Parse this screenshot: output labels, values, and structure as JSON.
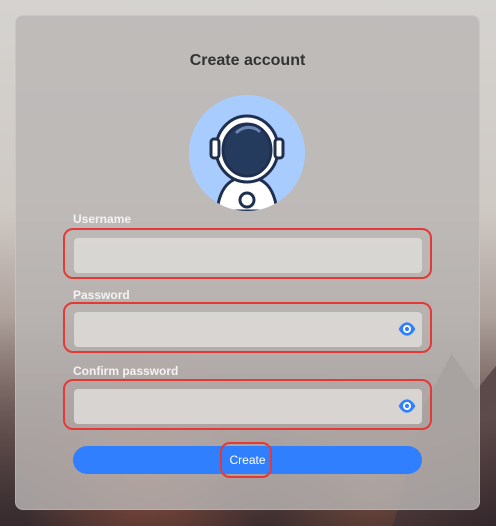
{
  "window": {
    "title": "Create account"
  },
  "form": {
    "username": {
      "label": "Username",
      "value": "",
      "placeholder": ""
    },
    "password": {
      "label": "Password",
      "value": "",
      "placeholder": ""
    },
    "confirm_password": {
      "label": "Confirm password",
      "value": "",
      "placeholder": ""
    },
    "create_button_label": "Create"
  },
  "icons": {
    "avatar": "astronaut-avatar",
    "password_visibility": "eye-icon"
  },
  "colors": {
    "accent": "#2f7fff",
    "highlight": "#e53935",
    "avatar_background": "#a9ccff"
  }
}
